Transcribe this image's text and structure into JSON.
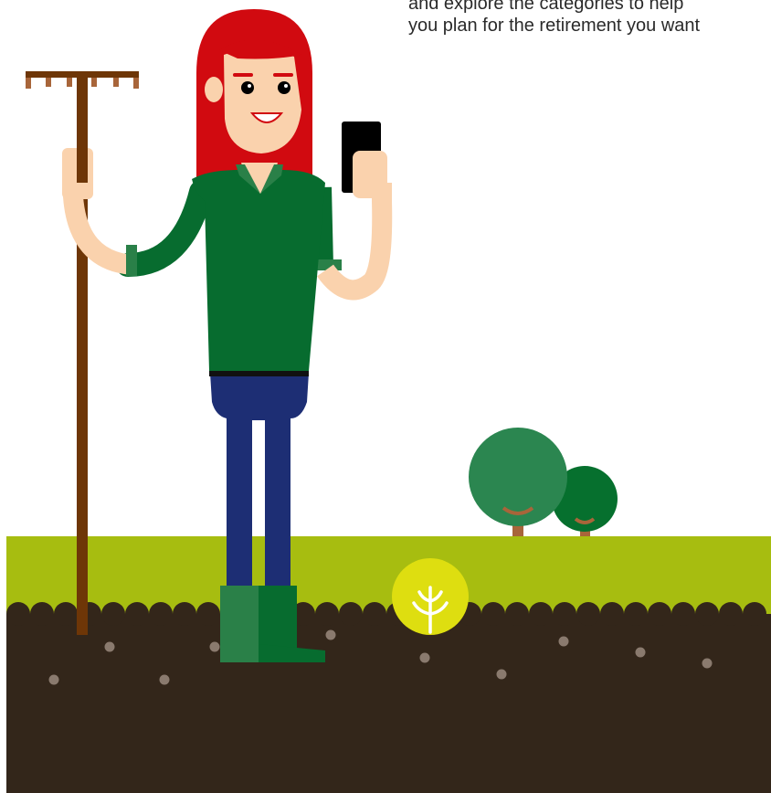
{
  "intro": {
    "line1": "and explore the categories to help",
    "line2": "you plan for the retirement you want"
  },
  "colors": {
    "grass": "#a7bd10",
    "soil": "#33261a",
    "pebble": "#8a7a6e",
    "hair": "#d10a10",
    "skin": "#fad2ad",
    "shirt": "#076c2f",
    "jeans": "#1d2e74",
    "boots": "#2a8048",
    "rake": "#6e3607",
    "phone": "#000000",
    "tree-large": "#2b8650",
    "tree-small": "#06702e",
    "trunk": "#a8653a",
    "seed-badge": "#dede10"
  },
  "icons": [
    "seedling-icon"
  ]
}
